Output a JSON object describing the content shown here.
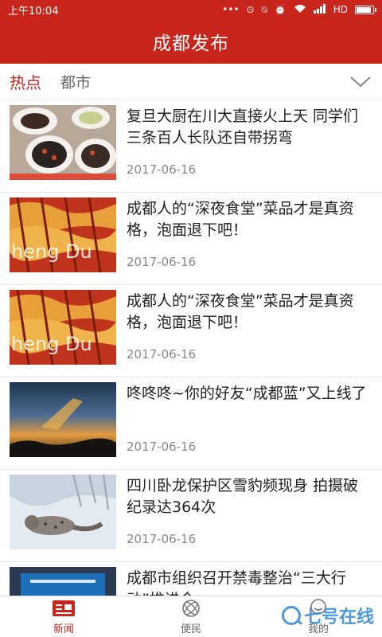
{
  "status_bar": {
    "time": "上午10:04",
    "dots": "•••",
    "network": "HD"
  },
  "app": {
    "title": "成都发布"
  },
  "tabs": [
    {
      "label": "热点",
      "active": true
    },
    {
      "label": "都市",
      "active": false
    }
  ],
  "articles": [
    {
      "title": "复旦大厨在川大直接火上天 同学们三条百人长队还自带拐弯",
      "date": "2017-06-16",
      "image": "food-dishes"
    },
    {
      "title": "成都人的“深夜食堂”菜品才是真资格，泡面退下吧！",
      "date": "2017-06-16",
      "image": "skewers-chengdu"
    },
    {
      "title": "成都人的“深夜食堂”菜品才是真资格，泡面退下吧！",
      "date": "2017-06-16",
      "image": "skewers-chengdu"
    },
    {
      "title": "咚咚咚~你的好友“成都蓝”又上线了",
      "date": "2017-06-16",
      "image": "sunset-sky"
    },
    {
      "title": "四川卧龙保护区雪豹频现身 拍摄破纪录达364次",
      "date": "2017-06-16",
      "image": "snow-leopard"
    },
    {
      "title": "成都市组织召开禁毒整治“三大行动”推进会",
      "date": "",
      "image": "meeting-hall"
    }
  ],
  "bottom_nav": [
    {
      "label": "新闻",
      "icon": "news-icon",
      "active": true
    },
    {
      "label": "便民",
      "icon": "service-icon",
      "active": false
    },
    {
      "label": "我的",
      "icon": "profile-icon",
      "active": false
    }
  ],
  "watermark": {
    "text": "七号在线"
  },
  "colors": {
    "brand": "#c8251c",
    "watermark": "#3d8fd8"
  }
}
